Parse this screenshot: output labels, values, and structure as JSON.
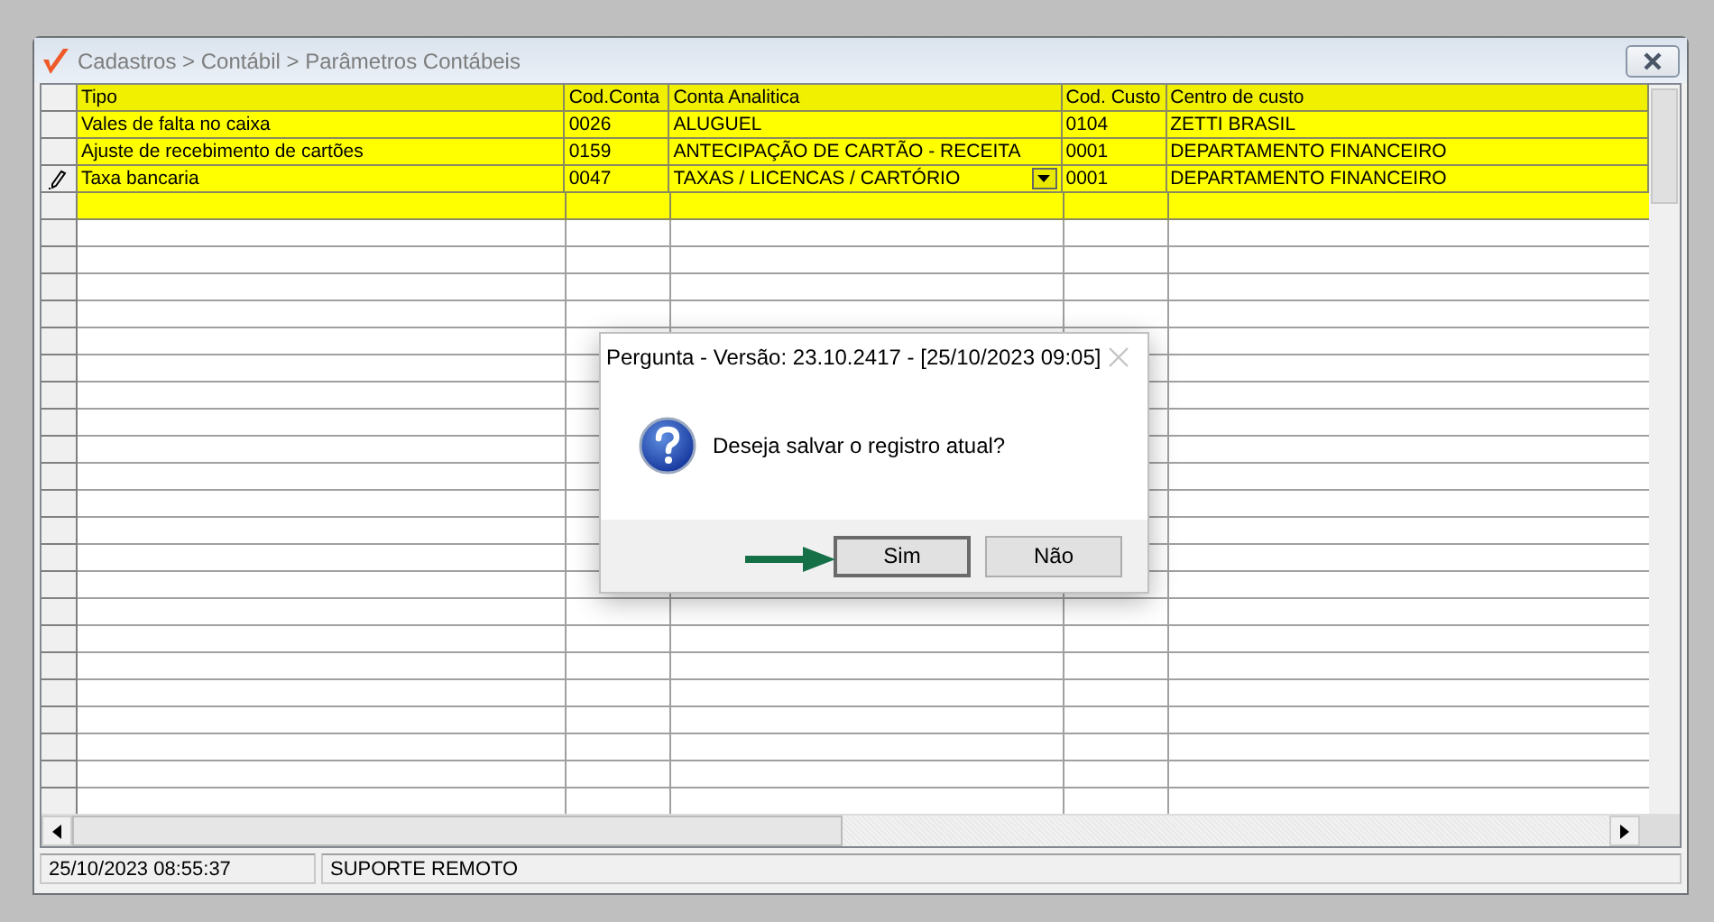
{
  "window": {
    "title": "Cadastros > Contábil > Parâmetros Contábeis"
  },
  "grid": {
    "columns": [
      "Tipo",
      "Cod.Conta",
      "Conta Analitica",
      "Cod. Custo",
      "Centro de custo"
    ],
    "rows": [
      {
        "editing": false,
        "cells": [
          "Vales de falta no caixa",
          "0026",
          "ALUGUEL",
          "0104",
          "ZETTI BRASIL"
        ]
      },
      {
        "editing": false,
        "cells": [
          "Ajuste de recebimento de cartões",
          "0159",
          "ANTECIPAÇÃO DE CARTÃO - RECEITA",
          "0001",
          "DEPARTAMENTO FINANCEIRO"
        ]
      },
      {
        "editing": true,
        "cells": [
          "Taxa bancaria",
          "0047",
          "TAXAS / LICENCAS / CARTÓRIO",
          "0001",
          "DEPARTAMENTO FINANCEIRO"
        ]
      }
    ],
    "new_row": true
  },
  "status_bar": [
    "25/10/2023 08:55:37",
    "SUPORTE REMOTO"
  ],
  "dialog": {
    "title": "Pergunta - Versão: 23.10.2417 - [25/10/2023 09:05]",
    "message": "Deseja salvar o registro atual?",
    "buttons": [
      {
        "label": "Sim",
        "default": true
      },
      {
        "label": "Não",
        "default": false
      }
    ]
  }
}
